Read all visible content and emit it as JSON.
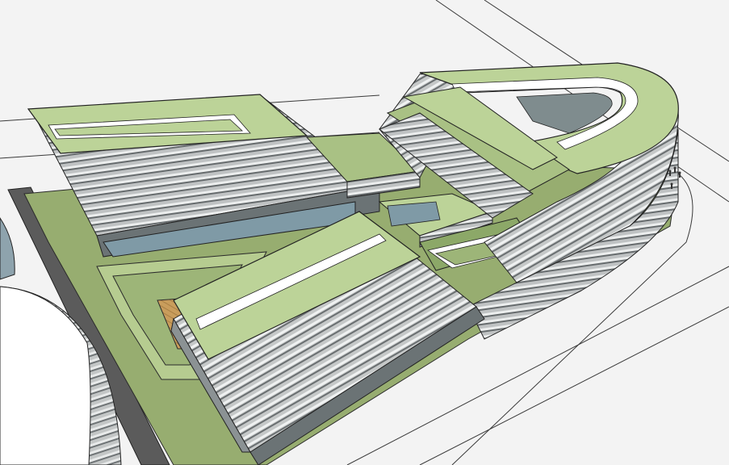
{
  "image": {
    "kind": "architectural massing render",
    "palette": {
      "ground": "#f1f1f1",
      "road": "#ffffff",
      "paving_dark": "#5e5e5e",
      "landscape": "#98b070",
      "landscape_dark": "#6f8c4c",
      "roof": "#bcd398",
      "roof_edge": "#ffffff",
      "facade_light": "#b9bcbc",
      "facade_dark": "#6c7173",
      "glass": "#7f9aa6",
      "deck": "#c69a58",
      "line": "#2b2b2b"
    }
  }
}
